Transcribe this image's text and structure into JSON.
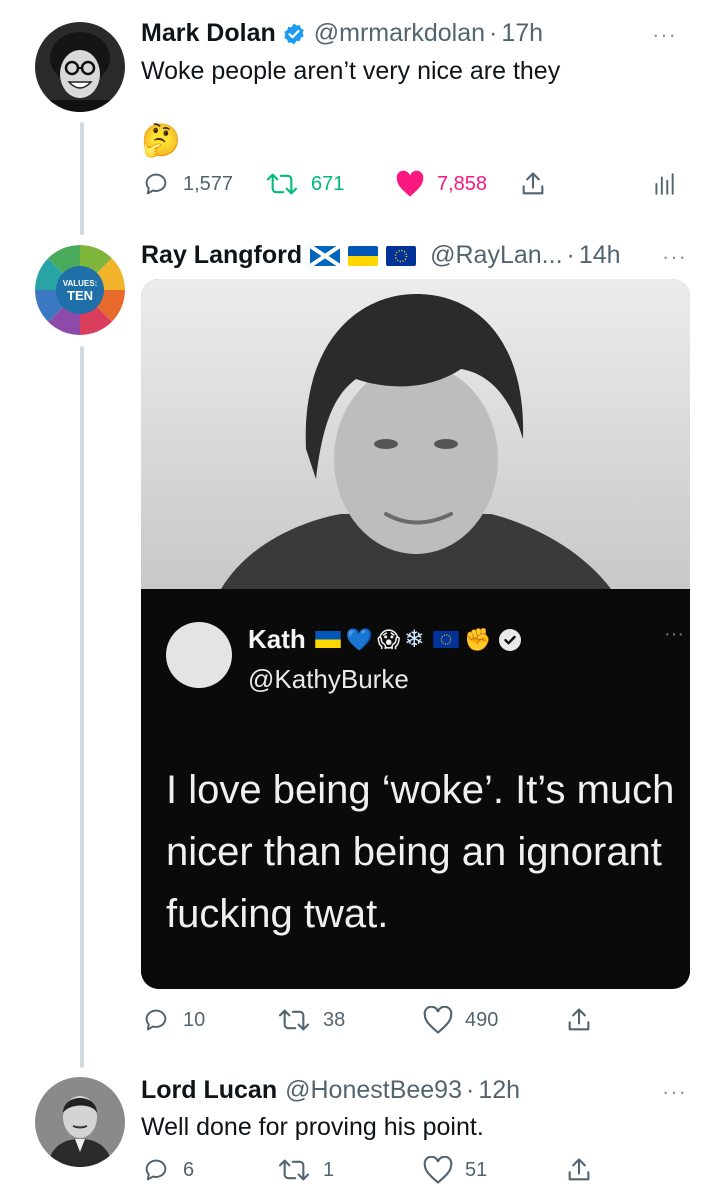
{
  "tweets": [
    {
      "name": "Mark Dolan",
      "handle": "@mrmarkdolan",
      "time": "17h",
      "text": "Woke people aren’t very nice are they",
      "emoji": "🤔",
      "verified": true,
      "replies": "1,577",
      "retweets": "671",
      "likes": "7,858",
      "liked": true,
      "retweeted": true
    },
    {
      "name": "Ray Langford",
      "handle": "@RayLan...",
      "time": "14h",
      "flags": [
        "scotland-flag",
        "ukraine-flag",
        "eu-flag"
      ],
      "replies": "10",
      "retweets": "38",
      "likes": "490",
      "avatar_text": {
        "line1": "VALUES:",
        "line2": "TEN"
      },
      "embedded": {
        "name": "Kath",
        "handle": "@KathyBurke",
        "text": "I love being ‘woke’. It’s much nicer than being an ignorant fucking twat.",
        "emojis": [
          "💙",
          "😱",
          "❄",
          "✊"
        ]
      }
    },
    {
      "name": "Lord Lucan",
      "handle": "@HonestBee93",
      "time": "12h",
      "text": "Well done for proving his point.",
      "replies": "6",
      "retweets": "1",
      "likes": "51"
    }
  ],
  "ui": {
    "separator": "·",
    "more": "···"
  },
  "colors": {
    "accent": "#1d9bf0",
    "like": "#f91880",
    "retweet": "#00ba7c",
    "muted": "#536471"
  }
}
